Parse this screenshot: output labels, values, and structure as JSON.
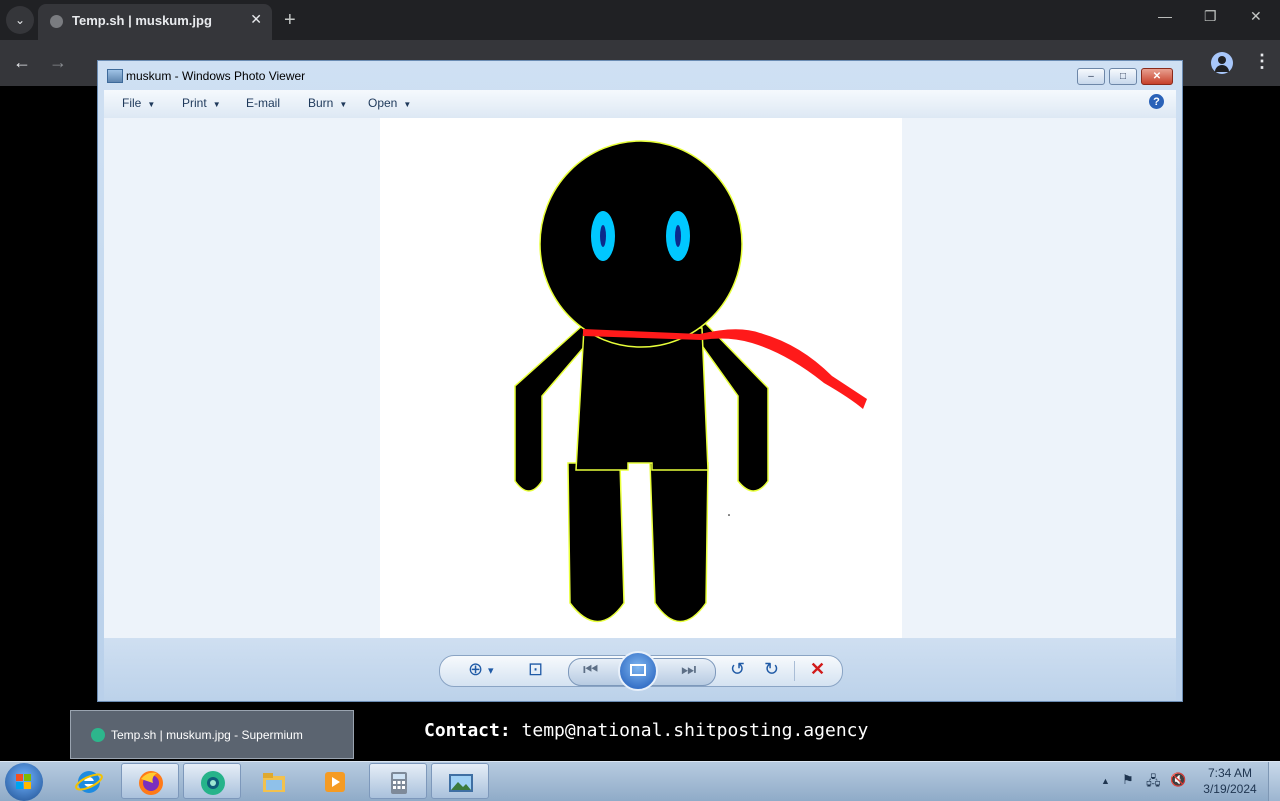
{
  "browser": {
    "tab_title": "Temp.sh | muskum.jpg",
    "tab_close": "✕",
    "new_tab": "+",
    "menu_caret": "⌄",
    "controls": {
      "minimize": "—",
      "maximize": "❐",
      "close": "✕"
    },
    "nav": {
      "back": "←",
      "forward": "→"
    },
    "kebab": "⋮"
  },
  "viewer": {
    "title": "muskum - Windows Photo Viewer",
    "title_buttons": {
      "minimize": "–",
      "maximize": "□",
      "close": "✕"
    },
    "menu": [
      {
        "label": "File",
        "caret": "▼"
      },
      {
        "label": "Print",
        "caret": "▼"
      },
      {
        "label": "E-mail"
      },
      {
        "label": "Burn",
        "caret": "▼"
      },
      {
        "label": "Open",
        "caret": "▼"
      }
    ],
    "help": "?",
    "controls": {
      "zoom": "⊕",
      "zoom_caret": "▾",
      "fit": "⊡",
      "previous": "⏮",
      "next": "⏭",
      "rotate_ccw": "↺",
      "rotate_cw": "↻",
      "delete": "✕"
    },
    "image": {
      "name": "muskum",
      "colors": {
        "body": "#000000",
        "outline": "#e8ff3a",
        "eyes": "#00c8ff",
        "pupils": "#0b2a8c",
        "scarf": "#ff1a1a"
      }
    }
  },
  "taskbar_preview": {
    "label": "Temp.sh | muskum.jpg - Supermium"
  },
  "contact": {
    "label": "Contact:",
    "email": "temp@national.shitposting.agency"
  },
  "taskbar": {
    "apps": [
      {
        "name": "internet-explorer-icon"
      },
      {
        "name": "firefox-icon"
      },
      {
        "name": "supermium-icon",
        "active": true
      },
      {
        "name": "file-explorer-icon"
      },
      {
        "name": "media-player-icon"
      },
      {
        "name": "calculator-icon"
      },
      {
        "name": "photo-viewer-icon"
      }
    ],
    "tray": {
      "chevron": "▲",
      "flag": "⚑",
      "network": "🖧",
      "volume": "🔇"
    },
    "time": "7:34 AM",
    "date": "3/19/2024"
  }
}
